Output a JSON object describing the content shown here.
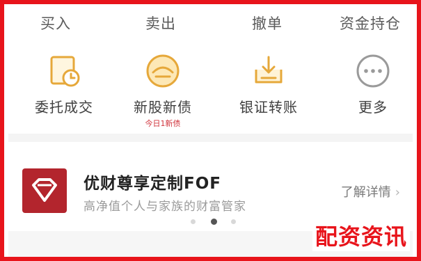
{
  "top_tabs": [
    {
      "label": "买入"
    },
    {
      "label": "卖出"
    },
    {
      "label": "撤单"
    },
    {
      "label": "资金持仓"
    }
  ],
  "functions": [
    {
      "label": "委托成交",
      "icon": "document-clock-icon"
    },
    {
      "label": "新股新债",
      "icon": "new-stock-bond-icon",
      "sub": "今日1新债"
    },
    {
      "label": "银证转账",
      "icon": "bank-transfer-icon"
    },
    {
      "label": "更多",
      "icon": "more-icon"
    }
  ],
  "promo": {
    "title": "优财尊享定制FOF",
    "description": "高净值个人与家族的财富管家",
    "link_label": "了解详情",
    "chevron": "›"
  },
  "pager": {
    "count": 3,
    "active_index": 2
  },
  "watermark": "配资资讯",
  "colors": {
    "frame_border": "#e8141b",
    "icon_gold": "#e6a83a",
    "promo_logo": "#b3252d",
    "watermark": "#e8141b",
    "sub_label": "#d0353d"
  }
}
